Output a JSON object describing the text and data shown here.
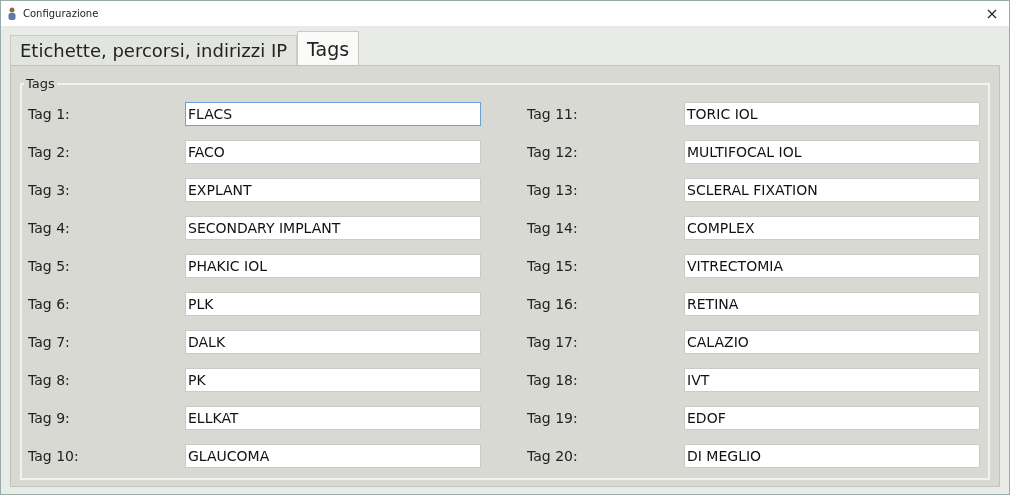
{
  "window": {
    "title": "Configurazione"
  },
  "tabs": [
    {
      "label": "Etichette, percorsi, indirizzi IP",
      "selected": false
    },
    {
      "label": "Tags",
      "selected": true
    }
  ],
  "group": {
    "title": "Tags"
  },
  "tags": [
    {
      "label": "Tag 1:",
      "value": "FLACS",
      "focused": true
    },
    {
      "label": "Tag 2:",
      "value": "FACO",
      "focused": false
    },
    {
      "label": "Tag 3:",
      "value": "EXPLANT",
      "focused": false
    },
    {
      "label": "Tag 4:",
      "value": "SECONDARY IMPLANT",
      "focused": false
    },
    {
      "label": "Tag 5:",
      "value": "PHAKIC IOL",
      "focused": false
    },
    {
      "label": "Tag 6:",
      "value": "PLK",
      "focused": false
    },
    {
      "label": "Tag 7:",
      "value": "DALK",
      "focused": false
    },
    {
      "label": "Tag 8:",
      "value": "PK",
      "focused": false
    },
    {
      "label": "Tag 9:",
      "value": "ELLKAT",
      "focused": false
    },
    {
      "label": "Tag 10:",
      "value": "GLAUCOMA",
      "focused": false
    },
    {
      "label": "Tag 11:",
      "value": "TORIC IOL",
      "focused": false
    },
    {
      "label": "Tag 12:",
      "value": "MULTIFOCAL IOL",
      "focused": false
    },
    {
      "label": "Tag 13:",
      "value": "SCLERAL FIXATION",
      "focused": false
    },
    {
      "label": "Tag 14:",
      "value": "COMPLEX",
      "focused": false
    },
    {
      "label": "Tag 15:",
      "value": "VITRECTOMIA",
      "focused": false
    },
    {
      "label": "Tag 16:",
      "value": "RETINA",
      "focused": false
    },
    {
      "label": "Tag 17:",
      "value": "CALAZIO",
      "focused": false
    },
    {
      "label": "Tag 18:",
      "value": "IVT",
      "focused": false
    },
    {
      "label": "Tag 19:",
      "value": "EDOF",
      "focused": false
    },
    {
      "label": "Tag 20:",
      "value": "DI MEGLIO",
      "focused": false
    }
  ]
}
